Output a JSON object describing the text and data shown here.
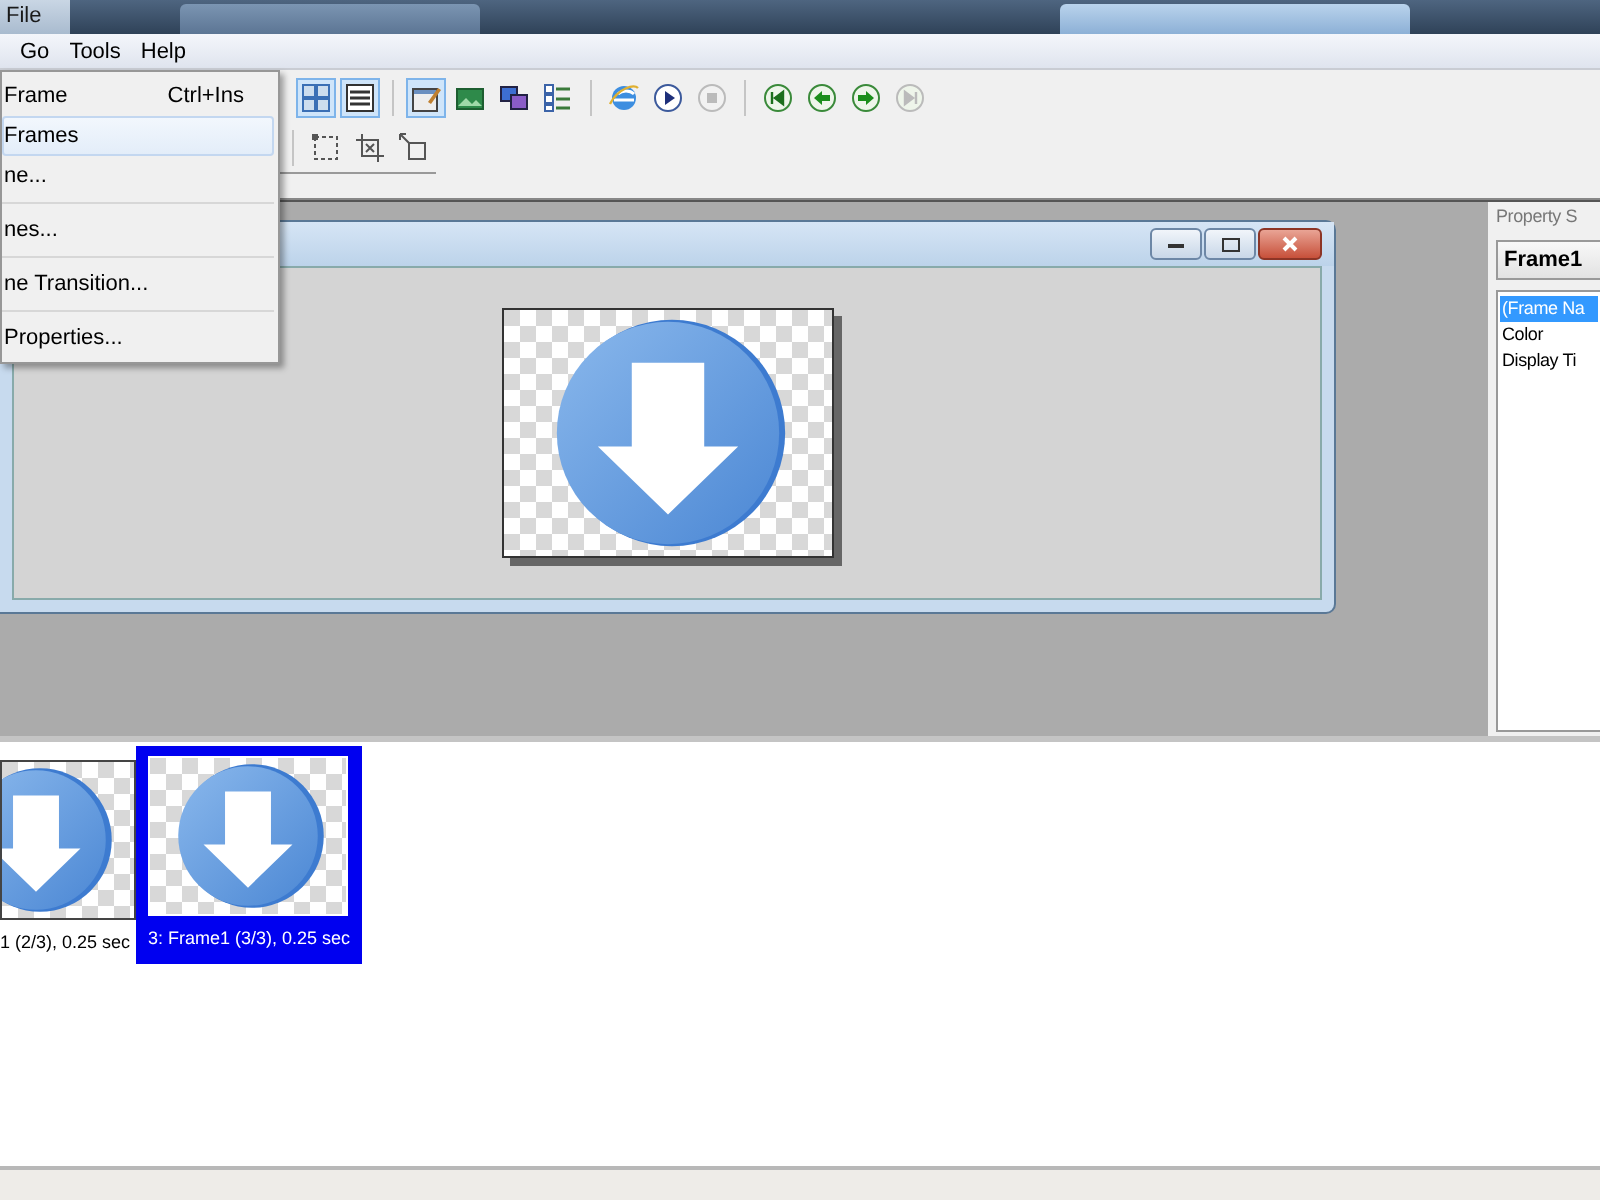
{
  "title_bar": {
    "title": "File"
  },
  "menu_bar": {
    "items": [
      {
        "label": "Go"
      },
      {
        "label": "Tools"
      },
      {
        "label": "Help"
      }
    ]
  },
  "toolbar": {
    "rows": [
      {
        "buttons": [
          {
            "kind": "button",
            "pressed": true,
            "disabled": false
          },
          {
            "kind": "button",
            "pressed": true,
            "disabled": false
          },
          {
            "kind": "separator"
          },
          {
            "kind": "button",
            "pressed": true,
            "disabled": false
          },
          {
            "kind": "button",
            "pressed": false,
            "disabled": false
          },
          {
            "kind": "button",
            "pressed": false,
            "disabled": false
          },
          {
            "kind": "button",
            "pressed": false,
            "disabled": false
          },
          {
            "kind": "separator"
          },
          {
            "kind": "button",
            "pressed": false,
            "disabled": false
          },
          {
            "kind": "button",
            "pressed": false,
            "disabled": false
          },
          {
            "kind": "button",
            "pressed": false,
            "disabled": true
          },
          {
            "kind": "separator"
          },
          {
            "kind": "button",
            "pressed": false,
            "disabled": false
          },
          {
            "kind": "button",
            "pressed": false,
            "disabled": false
          },
          {
            "kind": "button",
            "pressed": false,
            "disabled": false
          },
          {
            "kind": "button",
            "pressed": false,
            "disabled": true
          }
        ]
      },
      {
        "buttons": [
          {
            "kind": "separator"
          },
          {
            "kind": "button",
            "pressed": false,
            "disabled": false
          },
          {
            "kind": "button",
            "pressed": false,
            "disabled": false
          },
          {
            "kind": "button",
            "pressed": false,
            "disabled": false
          }
        ]
      }
    ]
  },
  "dropdown_menu": {
    "items": [
      {
        "kind": "item",
        "label": "Frame",
        "shortcut": "Ctrl+Ins",
        "selected": false
      },
      {
        "kind": "item",
        "label": "Frames",
        "selected": true
      },
      {
        "kind": "item",
        "label": "ne...",
        "selected": false
      },
      {
        "kind": "separator"
      },
      {
        "kind": "item",
        "label": "nes...",
        "selected": false
      },
      {
        "kind": "separator"
      },
      {
        "kind": "item",
        "label": "ne Transition...",
        "selected": false
      },
      {
        "kind": "separator"
      },
      {
        "kind": "item",
        "label": "Properties...",
        "selected": false
      }
    ]
  },
  "property_panel": {
    "title": "Property S",
    "object": "Frame1",
    "properties": [
      {
        "label": "(Frame Na",
        "selected": true
      },
      {
        "label": "Color",
        "selected": false
      },
      {
        "label": "Display Ti",
        "selected": false
      }
    ]
  },
  "filmstrip": {
    "frames": [
      {
        "label": "1 (2/3), 0.25 sec",
        "selected": false
      },
      {
        "label": "3: Frame1 (3/3), 0.25 sec",
        "selected": true
      }
    ]
  }
}
